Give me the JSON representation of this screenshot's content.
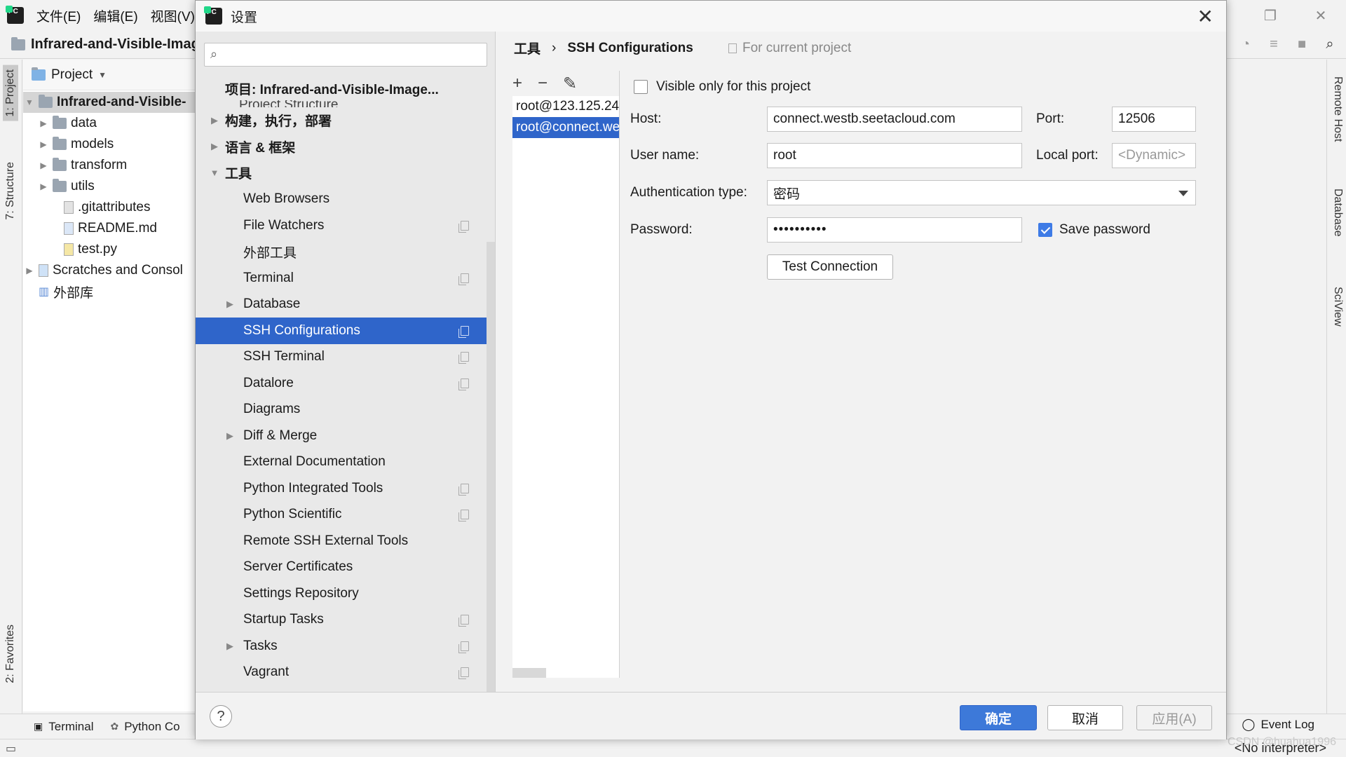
{
  "ide": {
    "menu": [
      "文件(E)",
      "编辑(E)",
      "视图(V)"
    ],
    "project_title": "Infrared-and-Visible-Imag",
    "project_panel_header": "Project",
    "tree": [
      {
        "label": "Infrared-and-Visible-",
        "root": true
      },
      {
        "label": "data"
      },
      {
        "label": "models"
      },
      {
        "label": "transform"
      },
      {
        "label": "utils"
      },
      {
        "label": ".gitattributes"
      },
      {
        "label": "README.md"
      },
      {
        "label": "test.py"
      },
      {
        "label": "Scratches and Consol"
      },
      {
        "label": "外部库"
      }
    ],
    "left_tabs": {
      "project": "1: Project",
      "structure": "7: Structure",
      "favorites": "2: Favorites"
    },
    "right_tabs": {
      "remote_host": "Remote Host",
      "database": "Database",
      "sciview": "SciView"
    },
    "bottom_tabs": {
      "terminal": "Terminal",
      "python_console": "Python Co"
    },
    "event_log": "Event Log",
    "interpreter": "<No interpreter>",
    "watermark": "CSDN @huahua1996"
  },
  "dialog": {
    "title": "设置",
    "nav": {
      "project_group": "项目: Infrared-and-Visible-Image...",
      "project_structure": "Project Structure",
      "build": "构建，执行，部署",
      "lang": "语言 & 框架",
      "tools": "工具",
      "items": [
        {
          "label": "Web Browsers",
          "copy": false,
          "arrow": false
        },
        {
          "label": "File Watchers",
          "copy": true,
          "arrow": false
        },
        {
          "label": "外部工具",
          "copy": false,
          "arrow": false
        },
        {
          "label": "Terminal",
          "copy": true,
          "arrow": false
        },
        {
          "label": "Database",
          "copy": false,
          "arrow": true
        },
        {
          "label": "SSH Configurations",
          "copy": true,
          "arrow": false,
          "selected": true
        },
        {
          "label": "SSH Terminal",
          "copy": true,
          "arrow": false
        },
        {
          "label": "Datalore",
          "copy": true,
          "arrow": false
        },
        {
          "label": "Diagrams",
          "copy": false,
          "arrow": false
        },
        {
          "label": "Diff & Merge",
          "copy": false,
          "arrow": true
        },
        {
          "label": "External Documentation",
          "copy": false,
          "arrow": false
        },
        {
          "label": "Python Integrated Tools",
          "copy": true,
          "arrow": false
        },
        {
          "label": "Python Scientific",
          "copy": true,
          "arrow": false
        },
        {
          "label": "Remote SSH External Tools",
          "copy": false,
          "arrow": false
        },
        {
          "label": "Server Certificates",
          "copy": false,
          "arrow": false
        },
        {
          "label": "Settings Repository",
          "copy": false,
          "arrow": false
        },
        {
          "label": "Startup Tasks",
          "copy": true,
          "arrow": false
        },
        {
          "label": "Tasks",
          "copy": true,
          "arrow": true
        },
        {
          "label": "Vagrant",
          "copy": true,
          "arrow": false
        }
      ]
    },
    "breadcrumb": {
      "parent": "工具",
      "sep": "›",
      "current": "SSH Configurations"
    },
    "scope": "For current project",
    "connections": [
      "root@123.125.24",
      "root@connect.we"
    ],
    "form": {
      "visible_only": "Visible only for this project",
      "host_label": "Host:",
      "host_value": "connect.westb.seetacloud.com",
      "port_label": "Port:",
      "port_value": "12506",
      "user_label": "User name:",
      "user_value": "root",
      "local_port_label": "Local port:",
      "local_port_placeholder": "<Dynamic>",
      "auth_label": "Authentication type:",
      "auth_value": "密码",
      "password_label": "Password:",
      "password_mask": "••••••••••",
      "save_password": "Save password",
      "test_connection": "Test Connection"
    },
    "footer": {
      "ok": "确定",
      "cancel": "取消",
      "apply": "应用(A)",
      "help": "?"
    }
  }
}
